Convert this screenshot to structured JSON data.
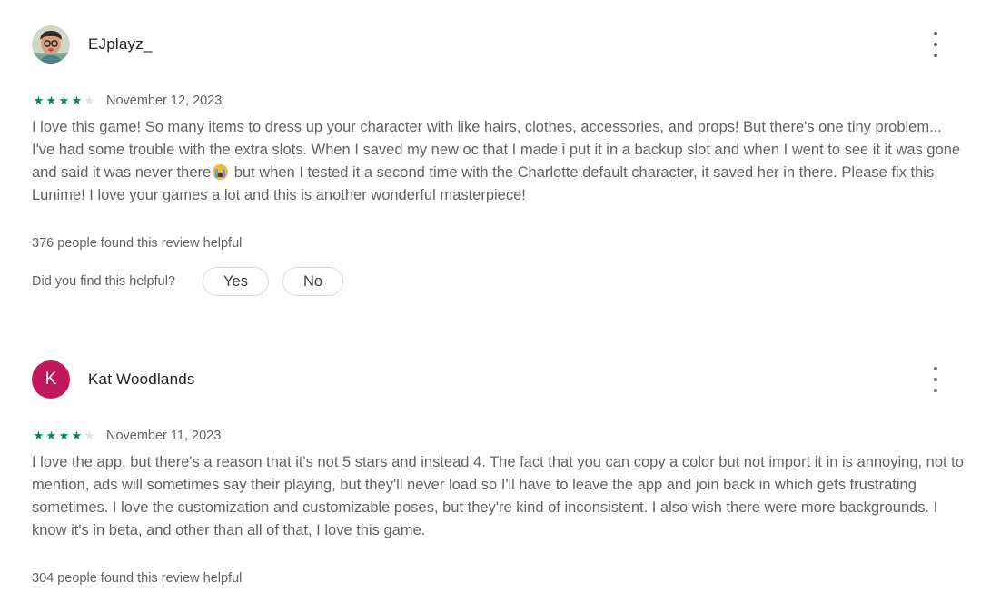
{
  "reviews": [
    {
      "author": "EJplayz_",
      "avatar_type": "photo",
      "rating": 4,
      "max_rating": 5,
      "date": "November 12, 2023",
      "text_before_emoji": "I love this game! So many items to dress up your character with like hairs, clothes, accessories, and props! But there's one tiny problem... I've had some trouble with the extra slots. When I saved my new oc that I made i put it in a backup slot and when I went to see it it was gone and said it was never there",
      "emoji": "loudly-crying-face",
      "text_after_emoji": " but when I tested it a second time with the Charlotte default character, it saved her in there. Please fix this Lunime! I love your games a lot and this is another wonderful masterpiece!",
      "helpful_count": "376 people found this review helpful",
      "helpful_question": "Did you find this helpful?",
      "yes_label": "Yes",
      "no_label": "No"
    },
    {
      "author": "Kat Woodlands",
      "avatar_type": "letter",
      "avatar_letter": "K",
      "avatar_color": "#c2185b",
      "rating": 4,
      "max_rating": 5,
      "date": "November 11, 2023",
      "text": "I love the app, but there's a reason that it's not 5 stars and instead 4. The fact that you can copy a color but not import it in is annoying, not to mention, ads will sometimes say their playing, but they'll never load so I'll have to leave the app and join back in which gets frustrating sometimes. I love the customization and customizable poses, but they're kind of inconsistent. I also wish there were more backgrounds. I know it's in beta, and other than all of that, I love this game.",
      "helpful_count": "304 people found this review helpful"
    }
  ],
  "colors": {
    "star_filled": "#01875f",
    "star_empty": "#e0e0e0",
    "text_secondary": "#5f6368"
  },
  "icons": {
    "more": "more-vert-icon",
    "star": "star-icon"
  }
}
